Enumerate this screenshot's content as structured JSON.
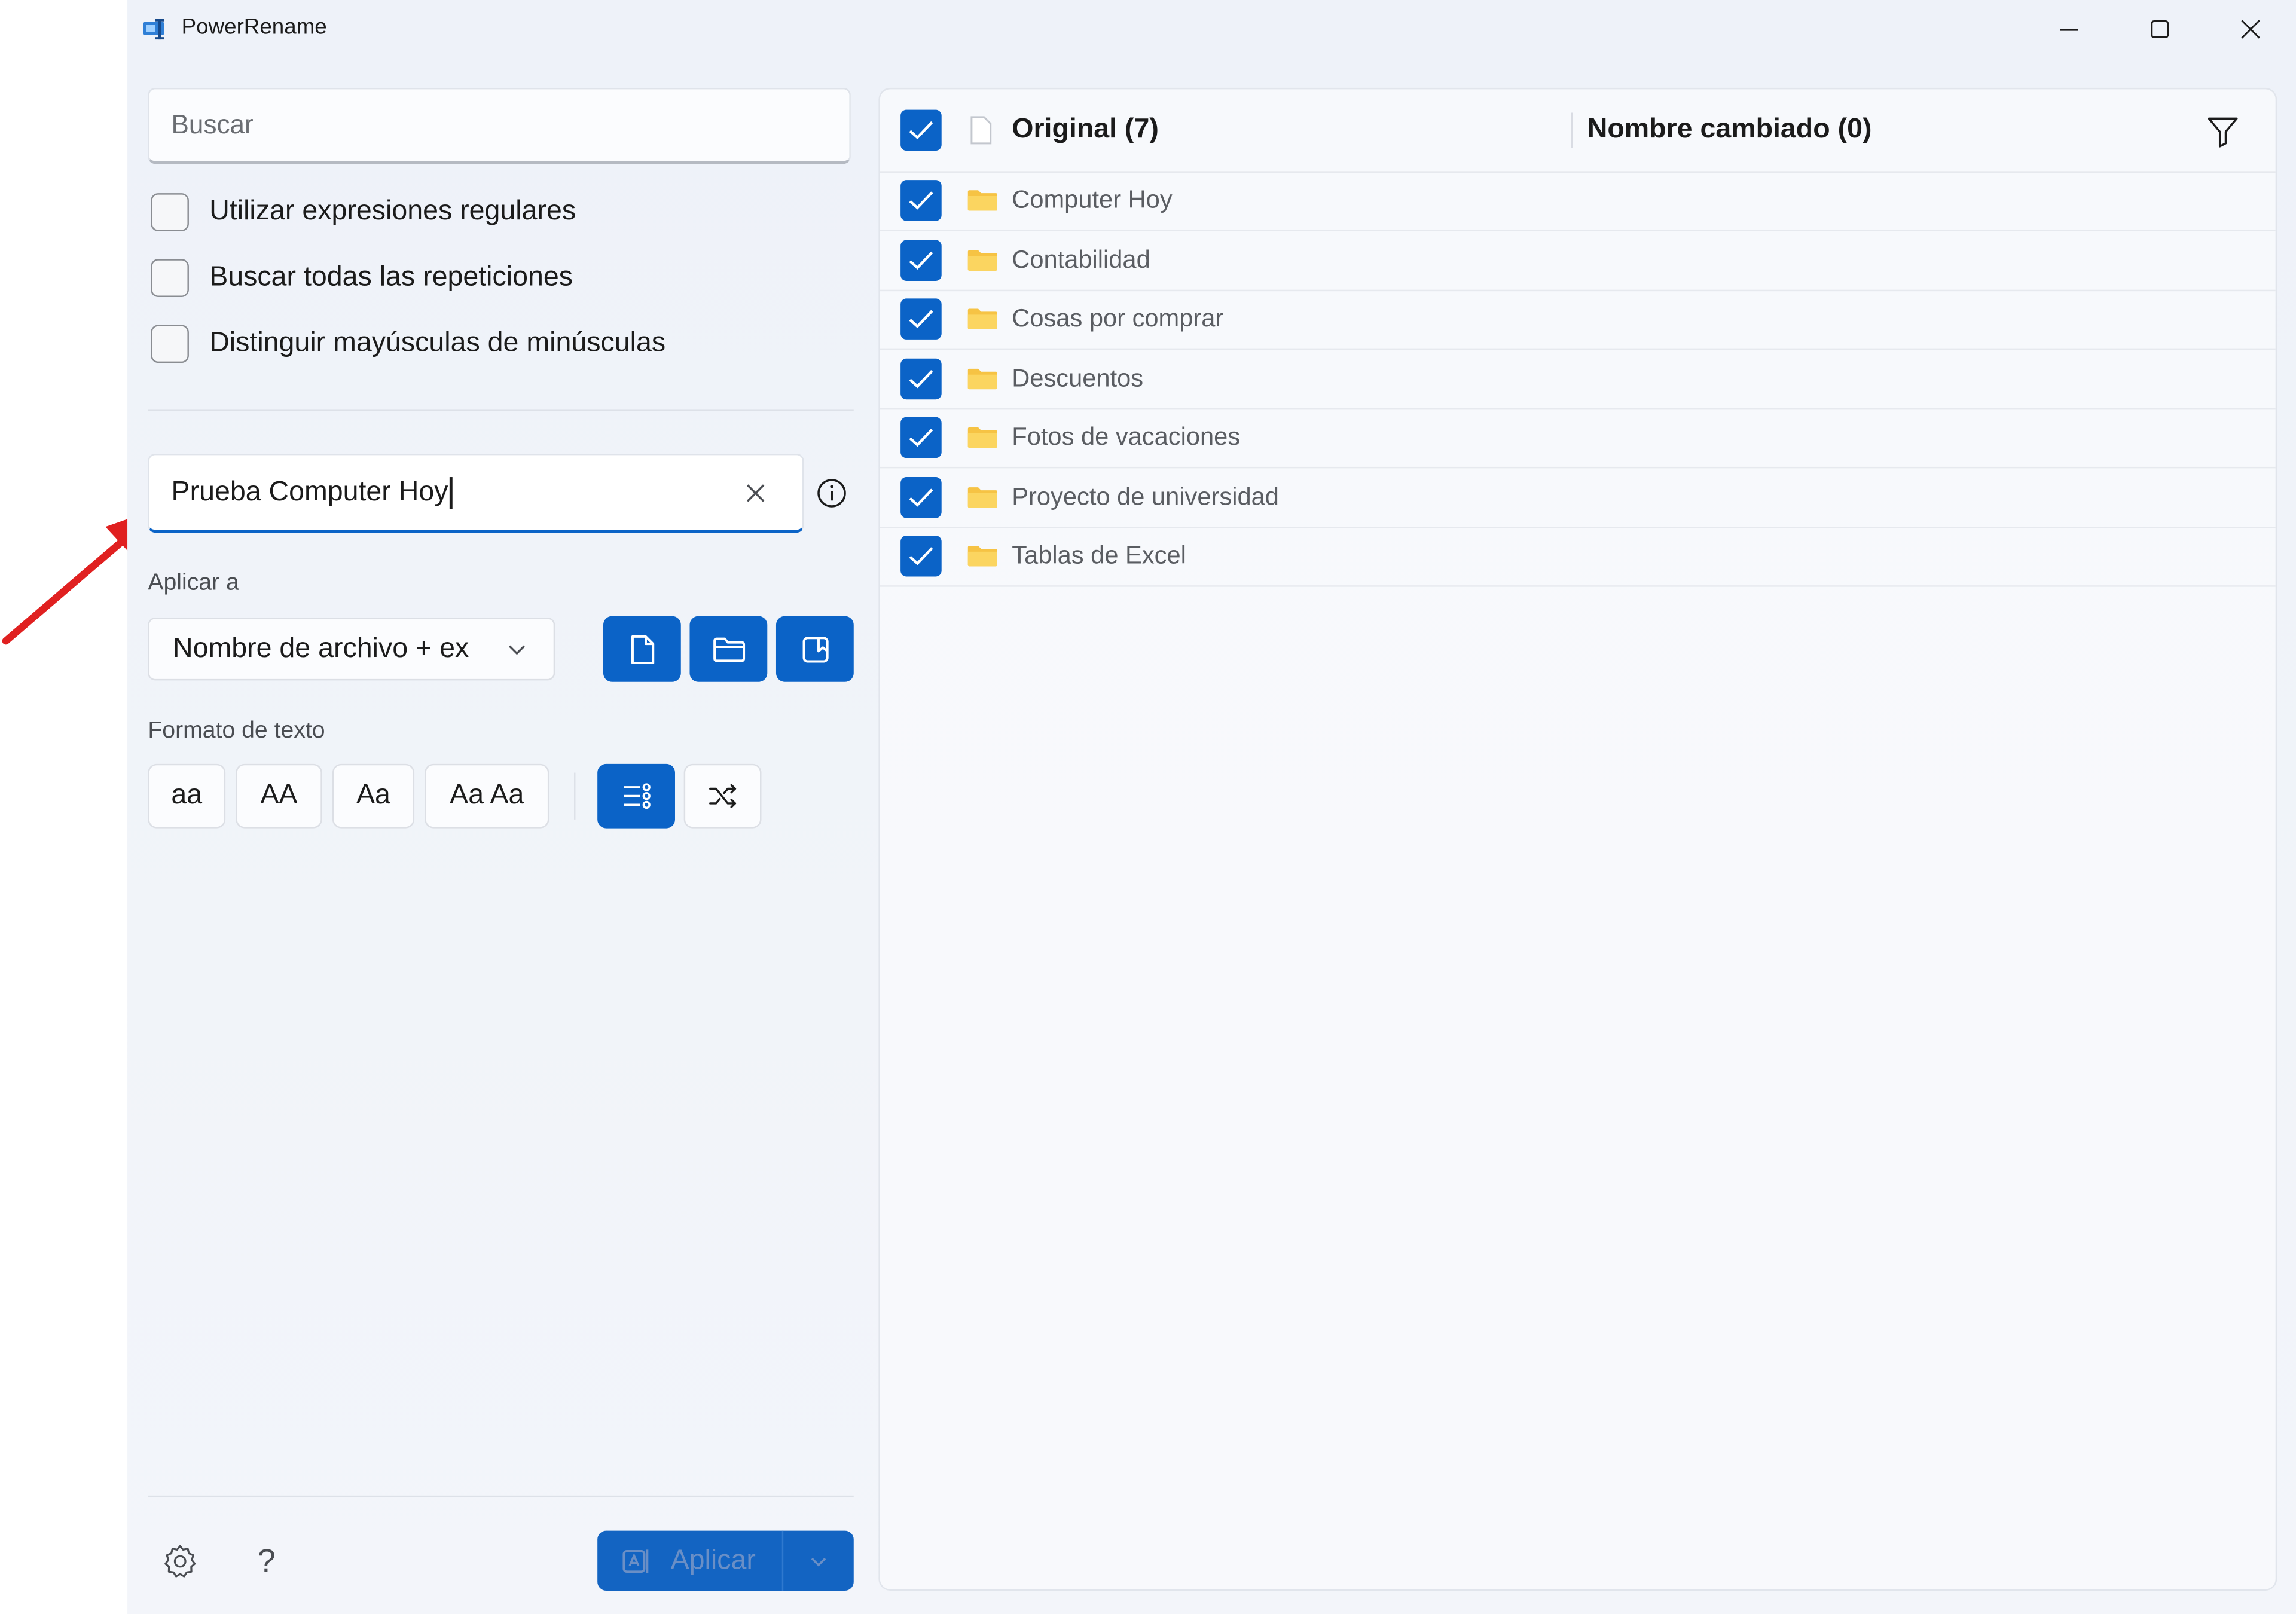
{
  "window": {
    "title": "PowerRename",
    "controls": {
      "minimize": "minimize-icon",
      "maximize": "maximize-icon",
      "close": "close-icon"
    }
  },
  "search": {
    "placeholder": "Buscar",
    "value": ""
  },
  "options": [
    {
      "label": "Utilizar expresiones regulares",
      "checked": false
    },
    {
      "label": "Buscar todas las repeticiones",
      "checked": false
    },
    {
      "label": "Distinguir mayúsculas de minúsculas",
      "checked": false
    }
  ],
  "replace": {
    "value": "Prueba Computer Hoy"
  },
  "apply_to": {
    "label": "Aplicar a",
    "selected": "Nombre de archivo + ex",
    "toggles": [
      "file-icon",
      "folder-icon",
      "subfolder-icon"
    ]
  },
  "text_format": {
    "label": "Formato de texto",
    "buttons": [
      "aa",
      "AA",
      "Aa",
      "Aa Aa"
    ],
    "extra": [
      "enumerate-icon",
      "shuffle-icon"
    ]
  },
  "footer": {
    "apply_label": "Aplicar"
  },
  "list": {
    "original_header": "Original (7)",
    "renamed_header": "Nombre cambiado (0)",
    "items": [
      {
        "name": "Computer Hoy",
        "checked": true
      },
      {
        "name": "Contabilidad",
        "checked": true
      },
      {
        "name": "Cosas por comprar",
        "checked": true
      },
      {
        "name": "Descuentos",
        "checked": true
      },
      {
        "name": "Fotos de vacaciones",
        "checked": true
      },
      {
        "name": "Proyecto de universidad",
        "checked": true
      },
      {
        "name": "Tablas de Excel",
        "checked": true
      }
    ]
  },
  "colors": {
    "accent": "#0b63c7",
    "folder": "#f6c344",
    "annotation_arrow": "#e02020"
  }
}
